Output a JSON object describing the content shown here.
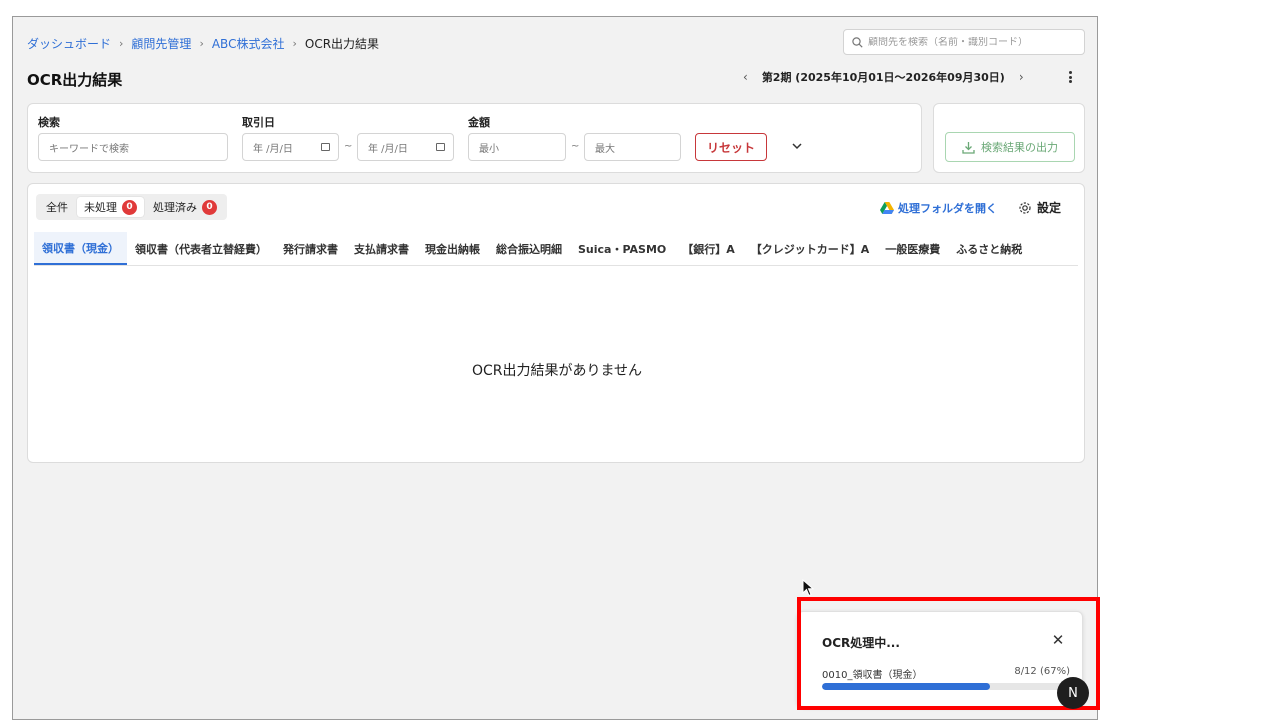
{
  "breadcrumb": {
    "items": [
      "ダッシュボード",
      "顧問先管理",
      "ABC株式会社"
    ],
    "current": "OCR出力結果"
  },
  "search": {
    "placeholder": "顧問先を検索（名前・識別コード）"
  },
  "page": {
    "title": "OCR出力結果"
  },
  "period": {
    "label": "第2期 (2025年10月01日〜2026年09月30日)"
  },
  "filters": {
    "keyword_label": "検索",
    "keyword_placeholder": "キーワードで検索",
    "date_label": "取引日",
    "date_from": "年 /月/日",
    "date_to": "年 /月/日",
    "amount_label": "金額",
    "amount_min": "最小",
    "amount_max": "最大",
    "tilde": "~",
    "reset_label": "リセット"
  },
  "export": {
    "label": "検索結果の出力"
  },
  "status_tabs": [
    {
      "label": "全件"
    },
    {
      "label": "未処理",
      "count": "0"
    },
    {
      "label": "処理済み",
      "count": "0"
    }
  ],
  "actions": {
    "open_folder": "処理フォルダを開く",
    "settings": "設定"
  },
  "category_tabs": [
    "領収書（現金）",
    "領収書（代表者立替経費）",
    "発行請求書",
    "支払請求書",
    "現金出納帳",
    "総合振込明細",
    "Suica・PASMO",
    "【銀行】A",
    "【クレジットカード】A",
    "一般医療費",
    "ふるさと納税"
  ],
  "empty_message": "OCR出力結果がありません",
  "toast": {
    "title": "OCR処理中...",
    "file": "0010_領収書（現金）",
    "count": "8/12 (67%)",
    "progress": 0.67
  },
  "fab": {
    "label": "N"
  },
  "colors": {
    "accent": "#2f6fd6",
    "danger": "#c7373a",
    "badge": "#e03a3a",
    "export": "#6aa876",
    "highlight": "#ff0000"
  }
}
